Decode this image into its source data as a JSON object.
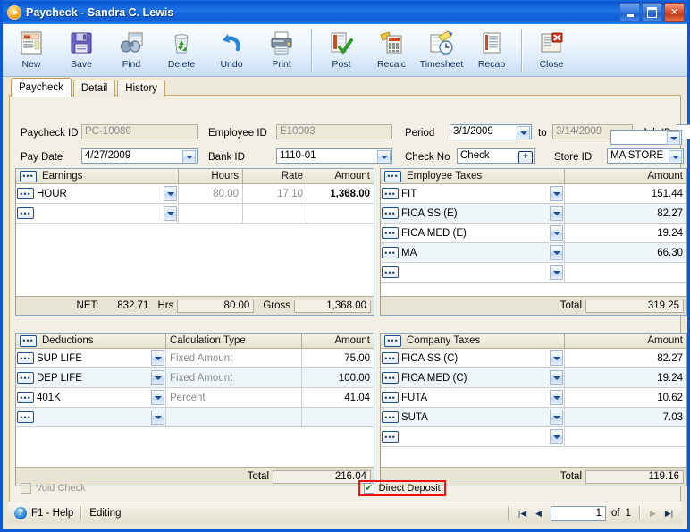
{
  "window": {
    "title": "Paycheck - Sandra C. Lewis",
    "icon": "play-circle-icon",
    "controls": {
      "minimize": "minimize-icon",
      "maximize": "maximize-icon",
      "close": "close-icon"
    }
  },
  "toolbar": {
    "buttons": [
      {
        "label": "New",
        "icon": "new-document-icon"
      },
      {
        "label": "Save",
        "icon": "floppy-disk-icon"
      },
      {
        "label": "Find",
        "icon": "binoculars-icon"
      },
      {
        "label": "Delete",
        "icon": "recycle-bin-icon"
      },
      {
        "label": "Undo",
        "icon": "undo-arrow-icon"
      },
      {
        "label": "Print",
        "icon": "printer-icon"
      },
      {
        "label": "Post",
        "icon": "post-checkmark-icon"
      },
      {
        "label": "Recalc",
        "icon": "calculator-icon"
      },
      {
        "label": "Timesheet",
        "icon": "timesheet-clock-icon"
      },
      {
        "label": "Recap",
        "icon": "recap-report-icon"
      },
      {
        "label": "Close",
        "icon": "close-window-icon"
      }
    ]
  },
  "tabs": [
    {
      "label": "Paycheck",
      "active": true
    },
    {
      "label": "Detail",
      "active": false
    },
    {
      "label": "History",
      "active": false
    }
  ],
  "form": {
    "paycheck_id": {
      "label": "Paycheck ID",
      "value": "PC-10080",
      "readonly": true
    },
    "employee_id": {
      "label": "Employee ID",
      "value": "E10003",
      "readonly": true
    },
    "period": {
      "label": "Period",
      "value": "3/1/2009"
    },
    "period_to": {
      "label": "to",
      "value": "3/14/2009",
      "readonly": true
    },
    "job_id": {
      "label": "Job ID",
      "value": ""
    },
    "pay_date": {
      "label": "Pay Date",
      "value": "4/27/2009"
    },
    "bank_id": {
      "label": "Bank ID",
      "value": "1110-01"
    },
    "check_no": {
      "label": "Check No",
      "value": "Check",
      "button": "plus-icon"
    },
    "store_id": {
      "label": "Store ID",
      "value": "MA STORE"
    }
  },
  "earnings": {
    "title": "Earnings",
    "columns": [
      "Earnings",
      "Hours",
      "Rate",
      "Amount"
    ],
    "rows": [
      {
        "name": "HOUR",
        "hours": "80.00",
        "rate": "17.10",
        "amount": "1,368.00"
      },
      {
        "name": "",
        "hours": "",
        "rate": "",
        "amount": ""
      }
    ],
    "summary": {
      "net_label": "NET:",
      "net_value": "832.71",
      "hrs_label": "Hrs",
      "hrs_value": "80.00",
      "gross_label": "Gross",
      "gross_value": "1,368.00"
    }
  },
  "employee_taxes": {
    "title": "Employee Taxes",
    "columns": [
      "Employee Taxes",
      "Amount"
    ],
    "rows": [
      {
        "name": "FIT",
        "amount": "151.44"
      },
      {
        "name": "FICA SS (E)",
        "amount": "82.27"
      },
      {
        "name": "FICA MED (E)",
        "amount": "19.24"
      },
      {
        "name": "MA",
        "amount": "66.30"
      },
      {
        "name": "",
        "amount": ""
      }
    ],
    "total_label": "Total",
    "total_value": "319.25"
  },
  "deductions": {
    "title": "Deductions",
    "columns": [
      "Deductions",
      "Calculation Type",
      "Amount"
    ],
    "rows": [
      {
        "name": "SUP LIFE",
        "calc": "Fixed Amount",
        "amount": "75.00"
      },
      {
        "name": "DEP LIFE",
        "calc": "Fixed Amount",
        "amount": "100.00"
      },
      {
        "name": "401K",
        "calc": "Percent",
        "amount": "41.04"
      },
      {
        "name": "",
        "calc": "",
        "amount": ""
      }
    ],
    "total_label": "Total",
    "total_value": "216.04"
  },
  "company_taxes": {
    "title": "Company Taxes",
    "columns": [
      "Company Taxes",
      "Amount"
    ],
    "rows": [
      {
        "name": "FICA SS (C)",
        "amount": "82.27"
      },
      {
        "name": "FICA MED (C)",
        "amount": "19.24"
      },
      {
        "name": "FUTA",
        "amount": "10.62"
      },
      {
        "name": "SUTA",
        "amount": "7.03"
      },
      {
        "name": "",
        "amount": ""
      }
    ],
    "total_label": "Total",
    "total_value": "119.16"
  },
  "options": {
    "void_check": {
      "label": "Void Check",
      "checked": false,
      "disabled": true
    },
    "direct_deposit": {
      "label": "Direct Deposit",
      "checked": true,
      "disabled": false,
      "highlight_color": "#ee1111"
    }
  },
  "statusbar": {
    "help": "F1 - Help",
    "mode": "Editing",
    "page": "1",
    "of_label": "of",
    "page_count": "1",
    "nav": {
      "first": "first-page-icon",
      "prev": "previous-page-icon",
      "next": "next-page-icon",
      "last": "last-page-icon"
    }
  },
  "colors": {
    "title_blue": "#0b59d6",
    "face": "#ece9d8",
    "panel": "#f2efe4",
    "grid_alt": "#eef6f9",
    "accent_red": "#ee1111"
  }
}
